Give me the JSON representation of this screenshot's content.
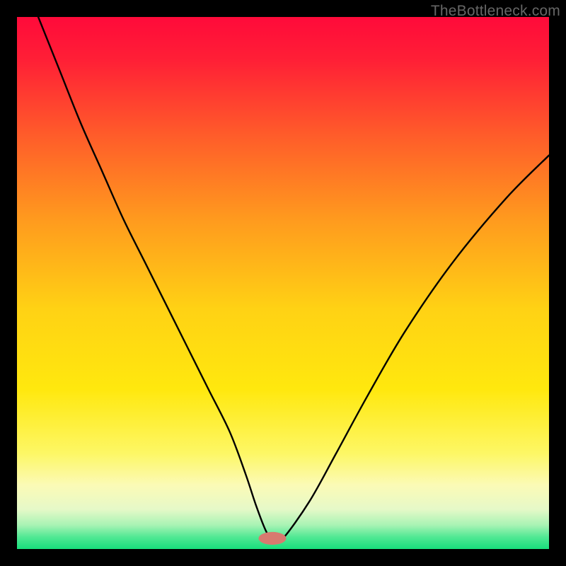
{
  "watermark": "TheBottleneck.com",
  "chart_data": {
    "type": "line",
    "title": "",
    "xlabel": "",
    "ylabel": "",
    "xlim": [
      0,
      100
    ],
    "ylim": [
      0,
      100
    ],
    "gradient_stops": [
      {
        "offset": 0.0,
        "color": "#ff0a3a"
      },
      {
        "offset": 0.08,
        "color": "#ff1f36"
      },
      {
        "offset": 0.22,
        "color": "#ff5b2a"
      },
      {
        "offset": 0.38,
        "color": "#ff9a1e"
      },
      {
        "offset": 0.55,
        "color": "#ffd214"
      },
      {
        "offset": 0.7,
        "color": "#ffe80e"
      },
      {
        "offset": 0.82,
        "color": "#fdf765"
      },
      {
        "offset": 0.88,
        "color": "#fbfab6"
      },
      {
        "offset": 0.925,
        "color": "#e6f9c8"
      },
      {
        "offset": 0.955,
        "color": "#a8f3b4"
      },
      {
        "offset": 0.978,
        "color": "#4fe893"
      },
      {
        "offset": 1.0,
        "color": "#18df7c"
      }
    ],
    "series": [
      {
        "name": "bottleneck-curve",
        "x": [
          4,
          8,
          12,
          16,
          20,
          24,
          28,
          32,
          36,
          40,
          43,
          45,
          47,
          48.5,
          50,
          55,
          60,
          66,
          73,
          82,
          92,
          100
        ],
        "y": [
          100,
          90,
          80,
          71,
          62,
          54,
          46,
          38,
          30,
          22,
          14,
          8,
          3,
          2,
          2,
          9,
          18,
          29,
          41,
          54,
          66,
          74
        ]
      }
    ],
    "marker": {
      "name": "optimal-point",
      "x": 48,
      "y": 2,
      "rx": 2.6,
      "ry": 1.2,
      "color": "#d87a6f"
    }
  }
}
